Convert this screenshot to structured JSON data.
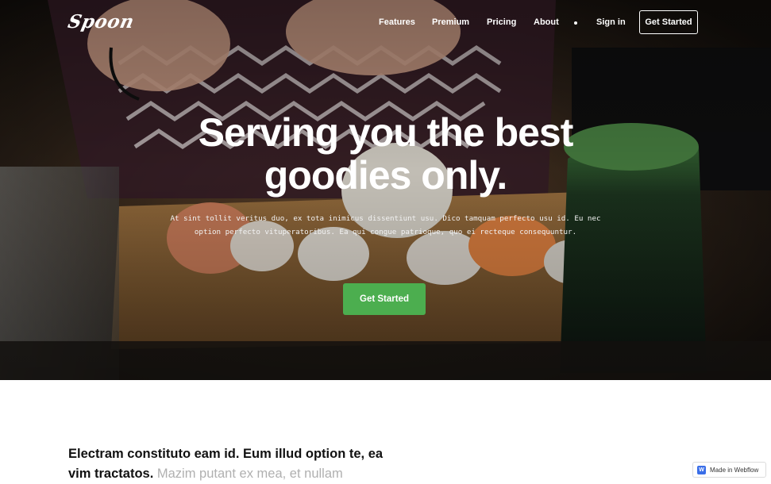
{
  "brand": {
    "logo_text": "Spoon"
  },
  "nav": {
    "links": [
      "Features",
      "Premium",
      "Pricing",
      "About",
      "Sign in"
    ],
    "cta_label": "Get Started"
  },
  "hero": {
    "title": "Serving you the best goodies only.",
    "subtitle": "At sint tollit veritus duo, ex tota inimicus dissentiunt usu. Dico tamquam perfecto usu id. Eu nec option perfecto vituperatoribus. Ea qui congue patrioque, quo ei recteque consequuntur.",
    "cta_label": "Get Started",
    "cta_color": "#4cae4f"
  },
  "content": {
    "intro_bold": "Electram constituto eam id. Eum illud option te, ea vim tractatos.",
    "intro_muted": "Mazim putant ex mea, et nullam"
  },
  "badge": {
    "icon_letter": "W",
    "label": "Made in Webflow"
  }
}
